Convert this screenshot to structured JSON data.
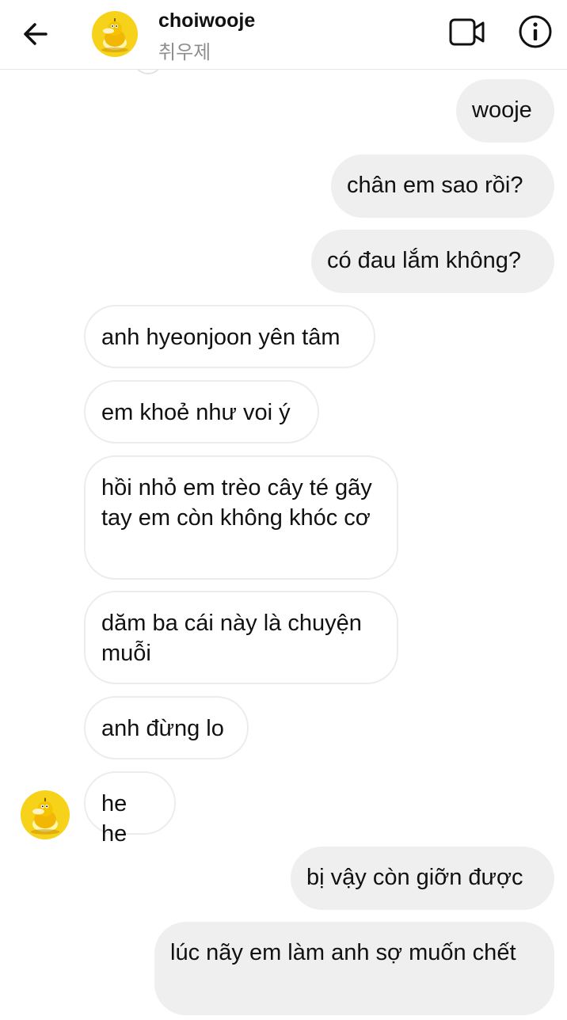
{
  "header": {
    "title": "choiwooje",
    "subtitle": "취우제"
  },
  "messages": [
    {
      "side": "out",
      "text": "wooje"
    },
    {
      "side": "out",
      "text": "chân em sao rồi?"
    },
    {
      "side": "out",
      "text": "có đau lắm không?"
    },
    {
      "side": "in",
      "text": "anh hyeonjoon yên tâm"
    },
    {
      "side": "in",
      "text": "em khoẻ như voi ý"
    },
    {
      "side": "in",
      "text": "hồi nhỏ em trèo cây té gãy tay em còn không khóc cơ"
    },
    {
      "side": "in",
      "text": "dăm ba cái này là chuyện muỗi"
    },
    {
      "side": "in",
      "text": "anh đừng lo"
    },
    {
      "side": "in",
      "text": "he he"
    },
    {
      "side": "out",
      "text": "bị vậy còn giỡn được"
    },
    {
      "side": "out",
      "text": "lúc nãy em làm anh sợ muốn chết"
    }
  ],
  "icons": {
    "back": "arrow-left-icon",
    "video": "video-camera-icon",
    "info": "info-icon",
    "avatar": "yellow-duck-avatar"
  },
  "colors": {
    "outgoing_bubble": "#efefef",
    "incoming_border": "#ececec",
    "avatar_yellow": "#f7d21b",
    "subtitle_gray": "#8e8e8e"
  }
}
